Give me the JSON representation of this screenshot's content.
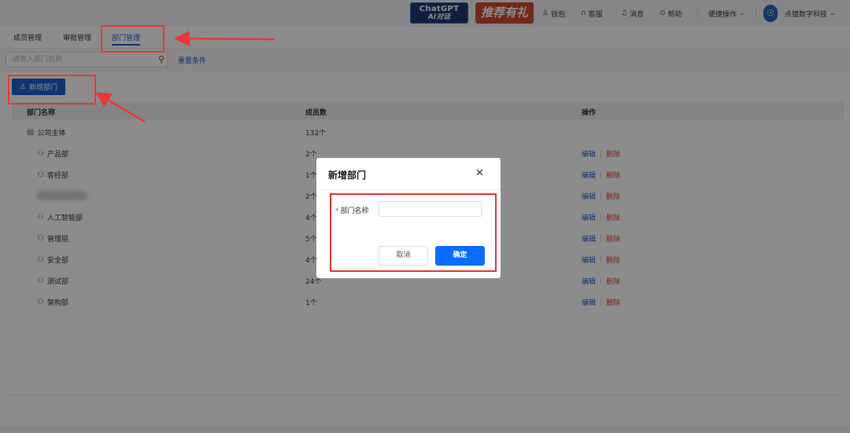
{
  "header": {
    "promo_chatgpt_line1": "ChatGPT",
    "promo_chatgpt_line2": "AI对话",
    "promo_recommend": "推荐有礼",
    "wallet": "钱包",
    "support": "客服",
    "messages": "消息",
    "help": "帮助",
    "quick_ops": "便捷操作",
    "company": "点镀数字科技"
  },
  "tabs": [
    {
      "label": "成员管理",
      "active": false
    },
    {
      "label": "审批管理",
      "active": false
    },
    {
      "label": "部门管理",
      "active": true
    }
  ],
  "search": {
    "placeholder": "请输入部门名称",
    "reset_label": "重置条件"
  },
  "toolbar": {
    "add_label": "新增部门"
  },
  "table": {
    "columns": [
      "部门名称",
      "成员数",
      "操作"
    ],
    "rows": [
      {
        "name": "公司主体",
        "count": "132个",
        "root": true
      },
      {
        "name": "产品部",
        "count": "2个",
        "edit": "编辑",
        "delete": "删除"
      },
      {
        "name": "客经部",
        "count": "1个",
        "edit": "编辑",
        "delete": "删除"
      },
      {
        "name": "",
        "count": "2个",
        "edit": "编辑",
        "delete": "删除",
        "blurred": true
      },
      {
        "name": "人工智能部",
        "count": "4个",
        "edit": "编辑",
        "delete": "删除"
      },
      {
        "name": "管理层",
        "count": "5个",
        "edit": "编辑",
        "delete": "删除"
      },
      {
        "name": "安全部",
        "count": "4个",
        "edit": "编辑",
        "delete": "删除"
      },
      {
        "name": "测试部",
        "count": "24个",
        "edit": "编辑",
        "delete": "删除"
      },
      {
        "name": "架构部",
        "count": "1个",
        "edit": "编辑",
        "delete": "删除"
      }
    ]
  },
  "modal": {
    "title": "新增部门",
    "field_label": "部门名称",
    "field_required": "*",
    "field_value": "",
    "cancel_label": "取消",
    "ok_label": "确定"
  },
  "colors": {
    "primary": "#1d5fcf",
    "confirm": "#0a6cff",
    "danger": "#e0423a",
    "annotation": "#e53935"
  }
}
